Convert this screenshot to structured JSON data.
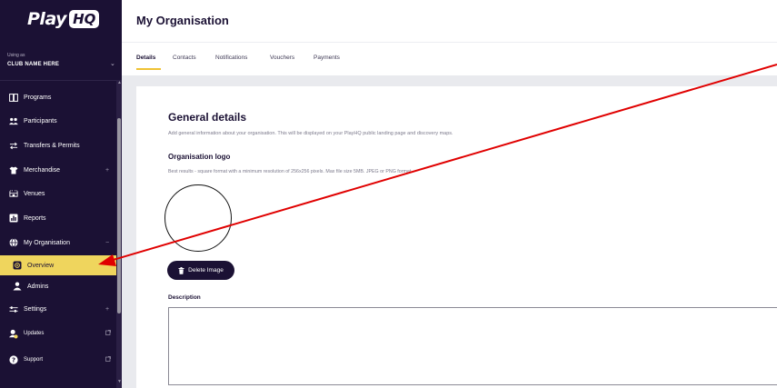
{
  "sidebar": {
    "brand_play": "Play",
    "brand_hq": "HQ",
    "using_as": "Using as",
    "club_name": "CLUB NAME HERE",
    "items": [
      {
        "label": "Programs",
        "icon": "book-icon"
      },
      {
        "label": "Participants",
        "icon": "people-icon"
      },
      {
        "label": "Transfers & Permits",
        "icon": "swap-arrows-icon"
      },
      {
        "label": "Merchandise",
        "icon": "shirt-icon",
        "suffix": "+"
      },
      {
        "label": "Venues",
        "icon": "stadium-icon"
      },
      {
        "label": "Reports",
        "icon": "report-icon"
      },
      {
        "label": "My Organisation",
        "icon": "globe-icon",
        "suffix": "−"
      },
      {
        "label": "Overview",
        "icon": "overview-icon"
      },
      {
        "label": "Admins",
        "icon": "admin-user-icon"
      },
      {
        "label": "Settings",
        "icon": "sliders-icon",
        "suffix": "+"
      },
      {
        "label": "Updates",
        "icon": "bell-user-icon"
      },
      {
        "label": "Support",
        "icon": "help-icon"
      }
    ]
  },
  "header": {
    "title": "My Organisation",
    "tabs": [
      {
        "label": "Details",
        "active": true
      },
      {
        "label": "Contacts"
      },
      {
        "label": "Notifications"
      },
      {
        "label": "Vouchers"
      },
      {
        "label": "Payments"
      }
    ]
  },
  "main": {
    "section_title": "General details",
    "section_desc": "Add general information about your organisation. This will be displayed on your PlayHQ public landing page and discovery maps.",
    "logo_title": "Organisation logo",
    "logo_desc": "Best results - square format with a minimum resolution of 256x256 pixels. Max file size 5MB. JPEG or PNG format.",
    "delete_label": "Delete Image",
    "description_label": "Description",
    "description_value": ""
  },
  "colors": {
    "sidebar_bg": "#1b1134",
    "active_item": "#efd55d",
    "accent_underline": "#efc233",
    "annotation_arrow": "#e00000"
  }
}
